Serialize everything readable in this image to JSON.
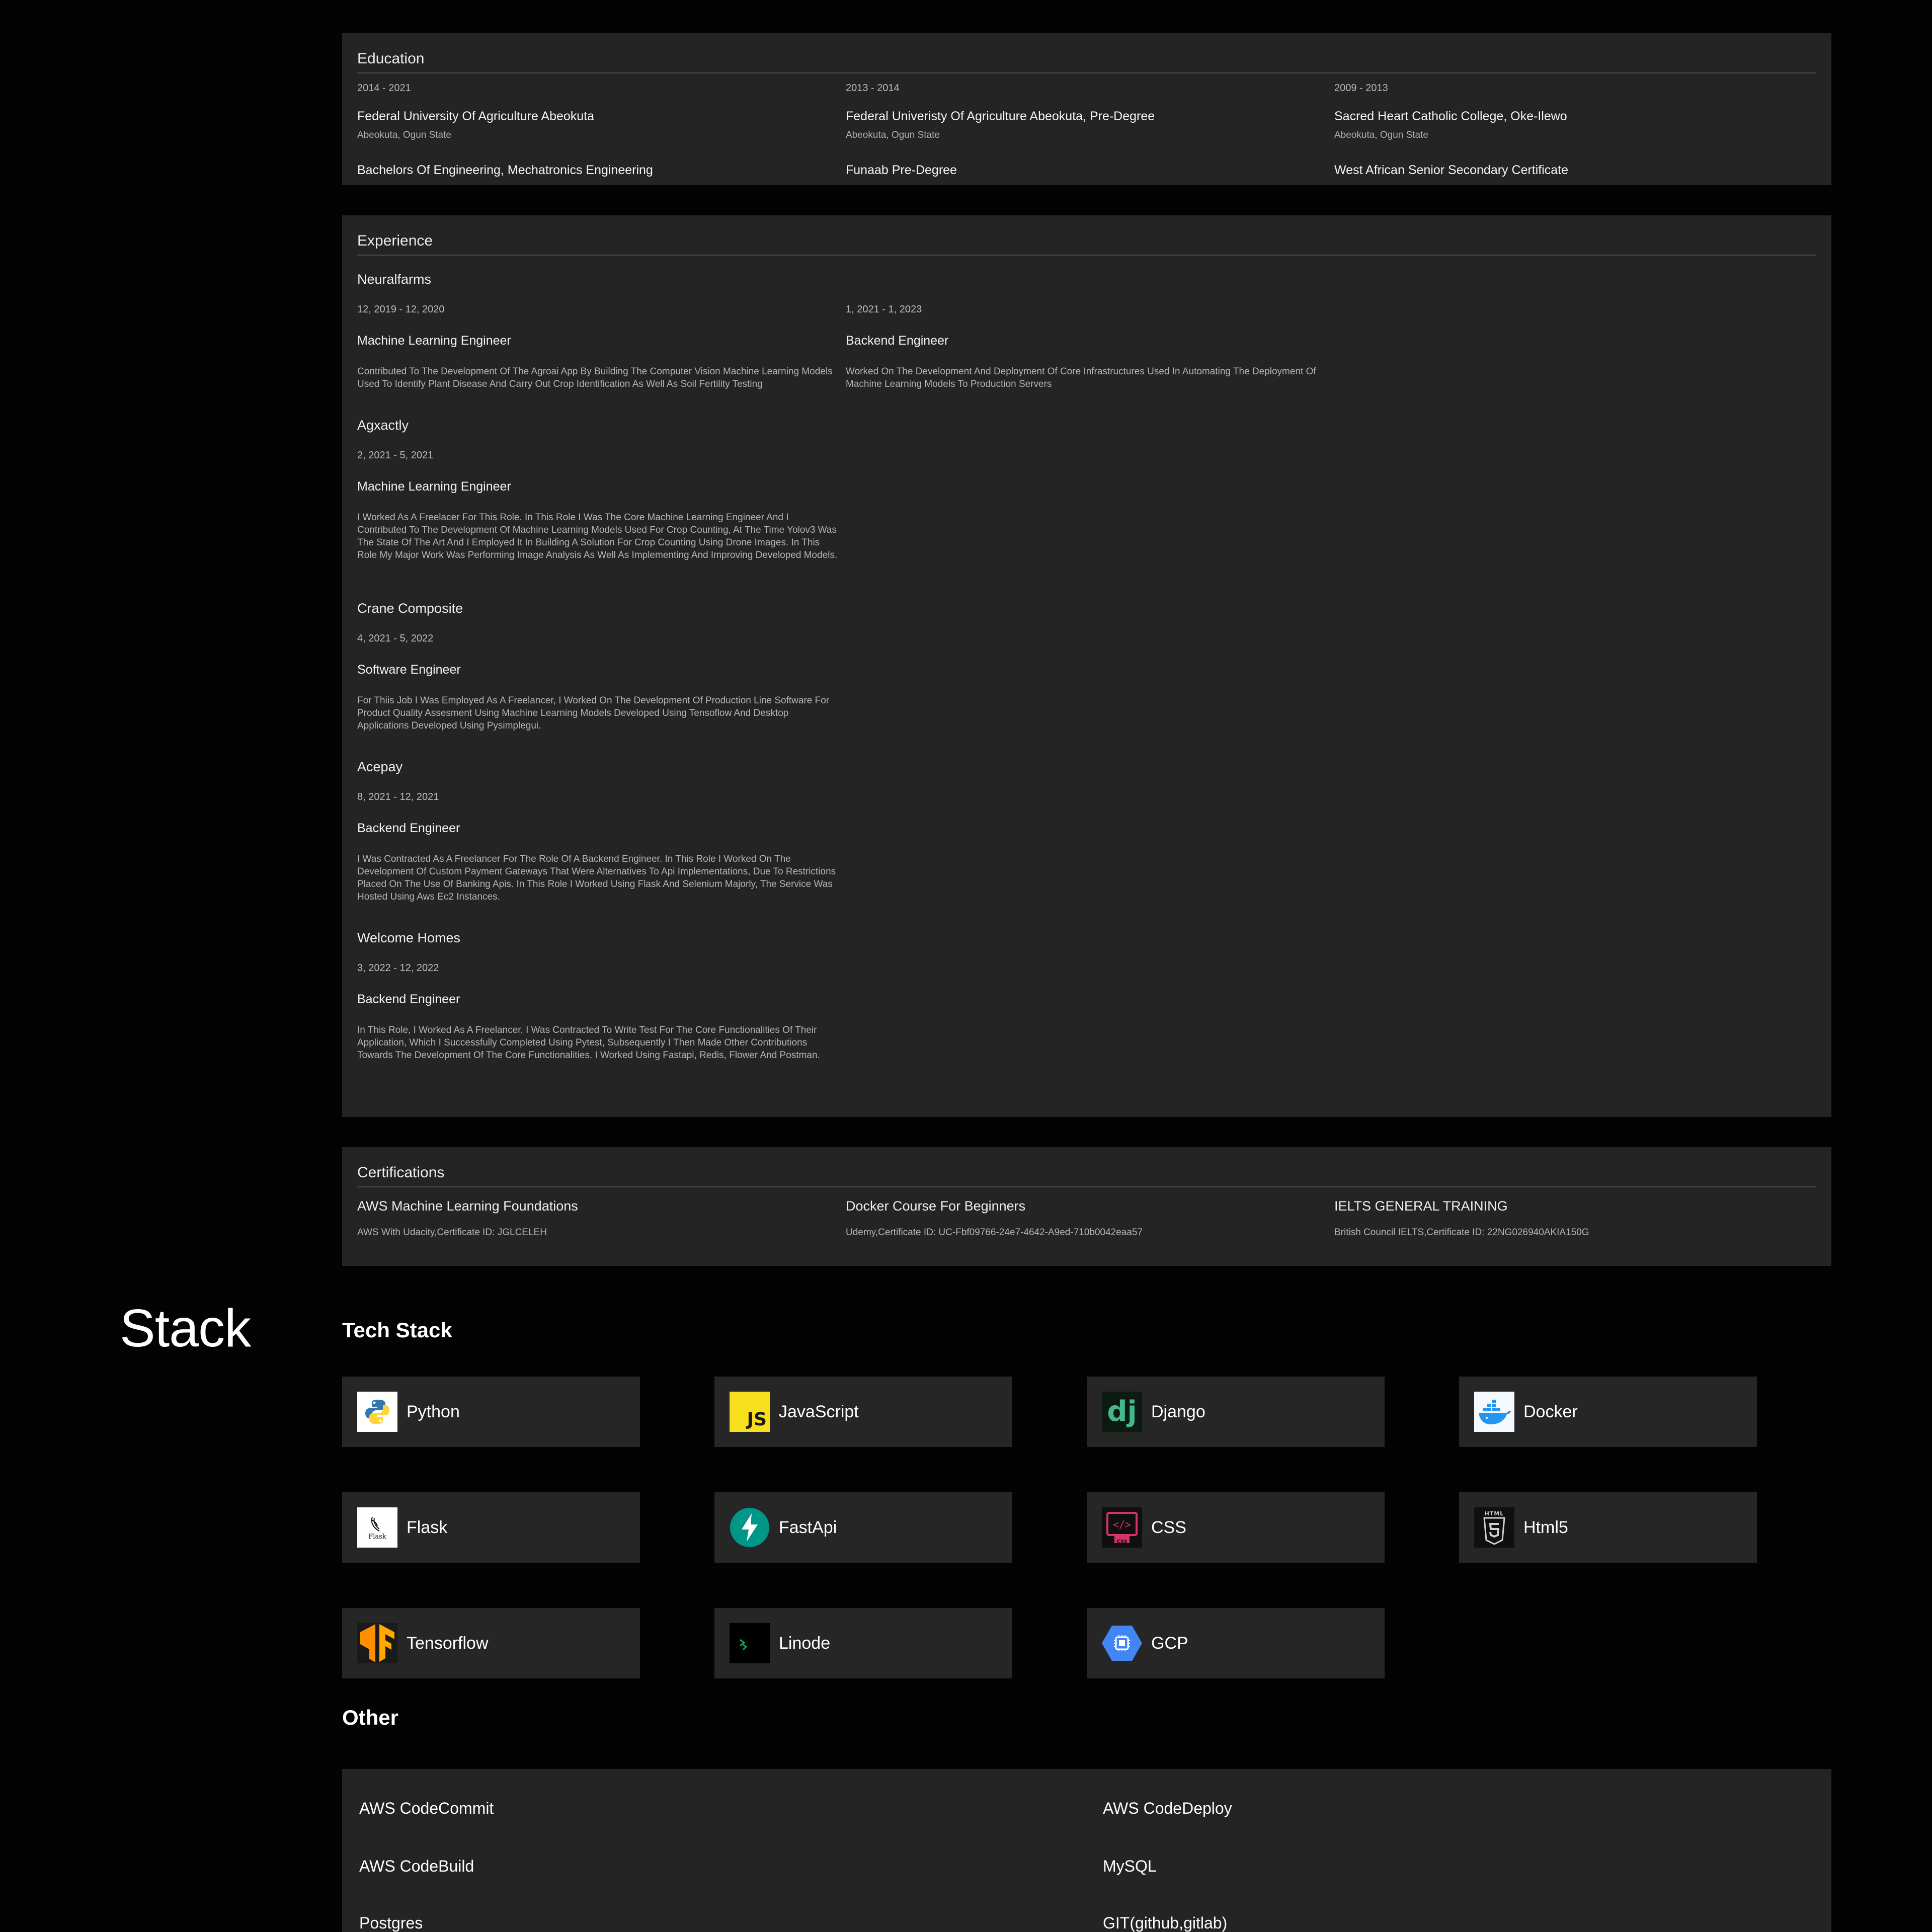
{
  "education": {
    "title": "Education",
    "items": [
      {
        "years": "2014 - 2021",
        "school": "Federal University Of Agriculture Abeokuta",
        "location": "Abeokuta, Ogun State",
        "degree": "Bachelors Of Engineering, Mechatronics Engineering"
      },
      {
        "years": "2013 - 2014",
        "school": "Federal Univeristy Of Agriculture Abeokuta, Pre-Degree",
        "location": "Abeokuta, Ogun State",
        "degree": "Funaab Pre-Degree"
      },
      {
        "years": "2009 - 2013",
        "school": "Sacred Heart Catholic College, Oke-Ilewo",
        "location": "Abeokuta, Ogun State",
        "degree": "West African Senior Secondary Certificate"
      }
    ]
  },
  "experience": {
    "title": "Experience",
    "companies": [
      {
        "name": "Neuralfarms",
        "roles": [
          {
            "dates": "12, 2019 - 12, 2020",
            "title": "Machine Learning Engineer",
            "description": "Contributed To The Development Of The Agroai App By Building The Computer Vision Machine Learning Models Used To Identify Plant Disease And Carry Out Crop Identification As Well As Soil Fertility Testing"
          },
          {
            "dates": "1, 2021 - 1, 2023",
            "title": "Backend Engineer",
            "description": "Worked On The Development And Deployment Of Core Infrastructures Used In Automating The Deployment Of Machine Learning Models To Production Servers"
          }
        ]
      },
      {
        "name": "Agxactly",
        "roles": [
          {
            "dates": "2, 2021 - 5, 2021",
            "title": "Machine Learning Engineer",
            "description": "I Worked As A Freelacer For This Role. In This Role I Was The Core Machine Learning Engineer And I Contributed To The Development Of Machine Learning Models Used For Crop Counting, At The Time Yolov3 Was The State Of The Art And I Employed It In Building A Solution For Crop Counting Using Drone Images. In This Role My Major Work Was Performing Image Analysis As Well As Implementing And Improving Developed Models."
          }
        ]
      },
      {
        "name": "Crane Composite",
        "roles": [
          {
            "dates": "4, 2021 - 5, 2022",
            "title": "Software Engineer",
            "description": "For Thiis Job I Was Employed As A Freelancer, I Worked On The Development Of Production Line Software For Product Quality Assesment Using Machine Learning Models Developed Using Tensoflow And Desktop Applications Developed Using Pysimplegui."
          }
        ]
      },
      {
        "name": "Acepay",
        "roles": [
          {
            "dates": "8, 2021 - 12, 2021",
            "title": "Backend Engineer",
            "description": "I Was Contracted As A Freelancer For The Role Of A Backend Engineer. In This Role I Worked On The Development Of Custom Payment Gateways That Were Alternatives To Api Implementations, Due To Restrictions Placed On The Use Of Banking Apis. In This Role I Worked Using Flask And Selenium Majorly, The Service Was Hosted Using Aws Ec2 Instances."
          }
        ]
      },
      {
        "name": "Welcome Homes",
        "roles": [
          {
            "dates": "3, 2022 - 12, 2022",
            "title": "Backend Engineer",
            "description": "In This Role, I Worked As A Freelancer, I Was Contracted To Write Test For The Core Functionalities Of Their Application, Which I Successfully Completed Using Pytest, Subsequently I Then Made Other Contributions Towards The Development Of The Core Functionalities. I Worked Using Fastapi, Redis, Flower And Postman."
          }
        ]
      }
    ]
  },
  "certifications": {
    "title": "Certifications",
    "items": [
      {
        "name": "AWS Machine Learning Foundations",
        "issuer": "AWS With Udacity,Certificate ID: JGLCELEH"
      },
      {
        "name": "Docker Course For Beginners",
        "issuer": "Udemy,Certificate ID: UC-Fbf09766-24e7-4642-A9ed-710b0042eaa57"
      },
      {
        "name": "IELTS GENERAL TRAINING",
        "issuer": "British Council IELTS,Certificate ID: 22NG026940AKIA150G"
      }
    ]
  },
  "stack": {
    "heading": "Stack",
    "tech_heading": "Tech Stack",
    "tech": [
      {
        "label": "Python",
        "icon": "python-icon"
      },
      {
        "label": "JavaScript",
        "icon": "javascript-icon",
        "icon_text": "JS"
      },
      {
        "label": "Django",
        "icon": "django-icon",
        "icon_text": "dj"
      },
      {
        "label": "Docker",
        "icon": "docker-icon"
      },
      {
        "label": "Flask",
        "icon": "flask-icon",
        "icon_text": "Flask"
      },
      {
        "label": "FastApi",
        "icon": "fastapi-icon"
      },
      {
        "label": "CSS",
        "icon": "css-icon",
        "icon_text": "CSS"
      },
      {
        "label": "Html5",
        "icon": "html5-icon",
        "icon_text": "HTML"
      },
      {
        "label": "Tensorflow",
        "icon": "tensorflow-icon"
      },
      {
        "label": "Linode",
        "icon": "linode-icon"
      },
      {
        "label": "GCP",
        "icon": "gcp-icon"
      }
    ],
    "other_heading": "Other",
    "other": [
      "AWS CodeCommit",
      "AWS CodeDeploy",
      "AWS CodeBuild",
      "MySQL",
      "Postgres",
      "GIT(github,gitlab)"
    ]
  },
  "colors": {
    "background": "#030303",
    "card": "#242424",
    "javascript_yellow": "#f7df1e",
    "django_green": "#44b78b",
    "docker_blue": "#2496ed",
    "fastapi_teal": "#009688",
    "css_pink": "#d6336c",
    "tensorflow_orange": "#ff8f00",
    "linode_green": "#02b159",
    "gcp_blue": "#4285f4"
  }
}
